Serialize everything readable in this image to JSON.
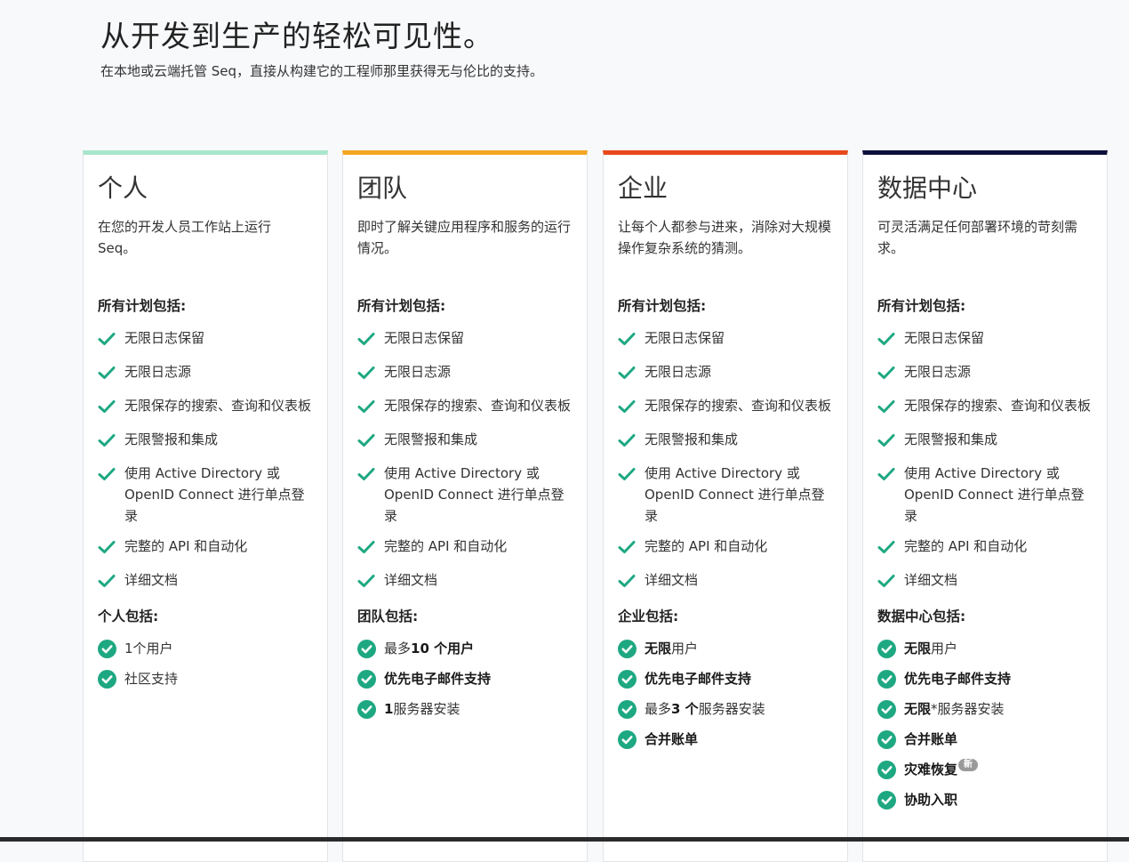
{
  "hero": {
    "title": "从开发到生产的轻松可见性。",
    "subtitle": "在本地或云端托管 Seq，直接从构建它的工程师那里获得无与伦比的支持。"
  },
  "colors": {
    "check": "#1ea882"
  },
  "plans": [
    {
      "name": "个人",
      "accent": "#a8e6cc",
      "description": "在您的开发人员工作站上运行 Seq。",
      "all_plans_heading": "所有计划包括:",
      "features": [
        "无限日志保留",
        "无限日志源",
        "无限保存的搜索、查询和仪表板",
        "无限警报和集成",
        "使用 Active Directory 或 OpenID Connect 进行单点登录",
        "完整的 API 和自动化",
        "详细文档"
      ],
      "includes_heading": "个人包括:",
      "includes": [
        {
          "bold": "",
          "text": "1个用户"
        },
        {
          "bold": "",
          "text": "社区支持"
        }
      ]
    },
    {
      "name": "团队",
      "accent": "#f5a623",
      "description": "即时了解关键应用程序和服务的运行情况。",
      "all_plans_heading": "所有计划包括:",
      "features": [
        "无限日志保留",
        "无限日志源",
        "无限保存的搜索、查询和仪表板",
        "无限警报和集成",
        "使用 Active Directory 或 OpenID Connect 进行单点登录",
        "完整的 API 和自动化",
        "详细文档"
      ],
      "includes_heading": "团队包括:",
      "includes": [
        {
          "bold": "",
          "text": "最多",
          "bold2": "10 个用户"
        },
        {
          "bold": "优先电子邮件支持",
          "text": ""
        },
        {
          "bold": "1",
          "text": "服务器安装"
        }
      ]
    },
    {
      "name": "企业",
      "accent": "#e8481c",
      "description": "让每个人都参与进来，消除对大规模操作复杂系统的猜测。",
      "all_plans_heading": "所有计划包括:",
      "features": [
        "无限日志保留",
        "无限日志源",
        "无限保存的搜索、查询和仪表板",
        "无限警报和集成",
        "使用 Active Directory 或 OpenID Connect 进行单点登录",
        "完整的 API 和自动化",
        "详细文档"
      ],
      "includes_heading": "企业包括:",
      "includes": [
        {
          "bold": "无限",
          "text": "用户"
        },
        {
          "bold": "优先电子邮件支持",
          "text": ""
        },
        {
          "bold": "",
          "text": "最多",
          "bold2": "3 个",
          "text2": "服务器安装"
        },
        {
          "bold": "合并账单",
          "text": ""
        }
      ]
    },
    {
      "name": "数据中心",
      "accent": "#0f0f3c",
      "description": "可灵活满足任何部署环境的苛刻需求。",
      "all_plans_heading": "所有计划包括:",
      "features": [
        "无限日志保留",
        "无限日志源",
        "无限保存的搜索、查询和仪表板",
        "无限警报和集成",
        "使用 Active Directory 或 OpenID Connect 进行单点登录",
        "完整的 API 和自动化",
        "详细文档"
      ],
      "includes_heading": "数据中心包括:",
      "includes": [
        {
          "bold": "无限",
          "text": "用户"
        },
        {
          "bold": "优先电子邮件支持",
          "text": ""
        },
        {
          "bold": "无限",
          "text": "*服务器安装"
        },
        {
          "bold": "合并账单",
          "text": ""
        },
        {
          "bold": "灾难恢复",
          "text": "",
          "badge": "新"
        },
        {
          "bold": "协助入职",
          "text": ""
        }
      ]
    }
  ]
}
